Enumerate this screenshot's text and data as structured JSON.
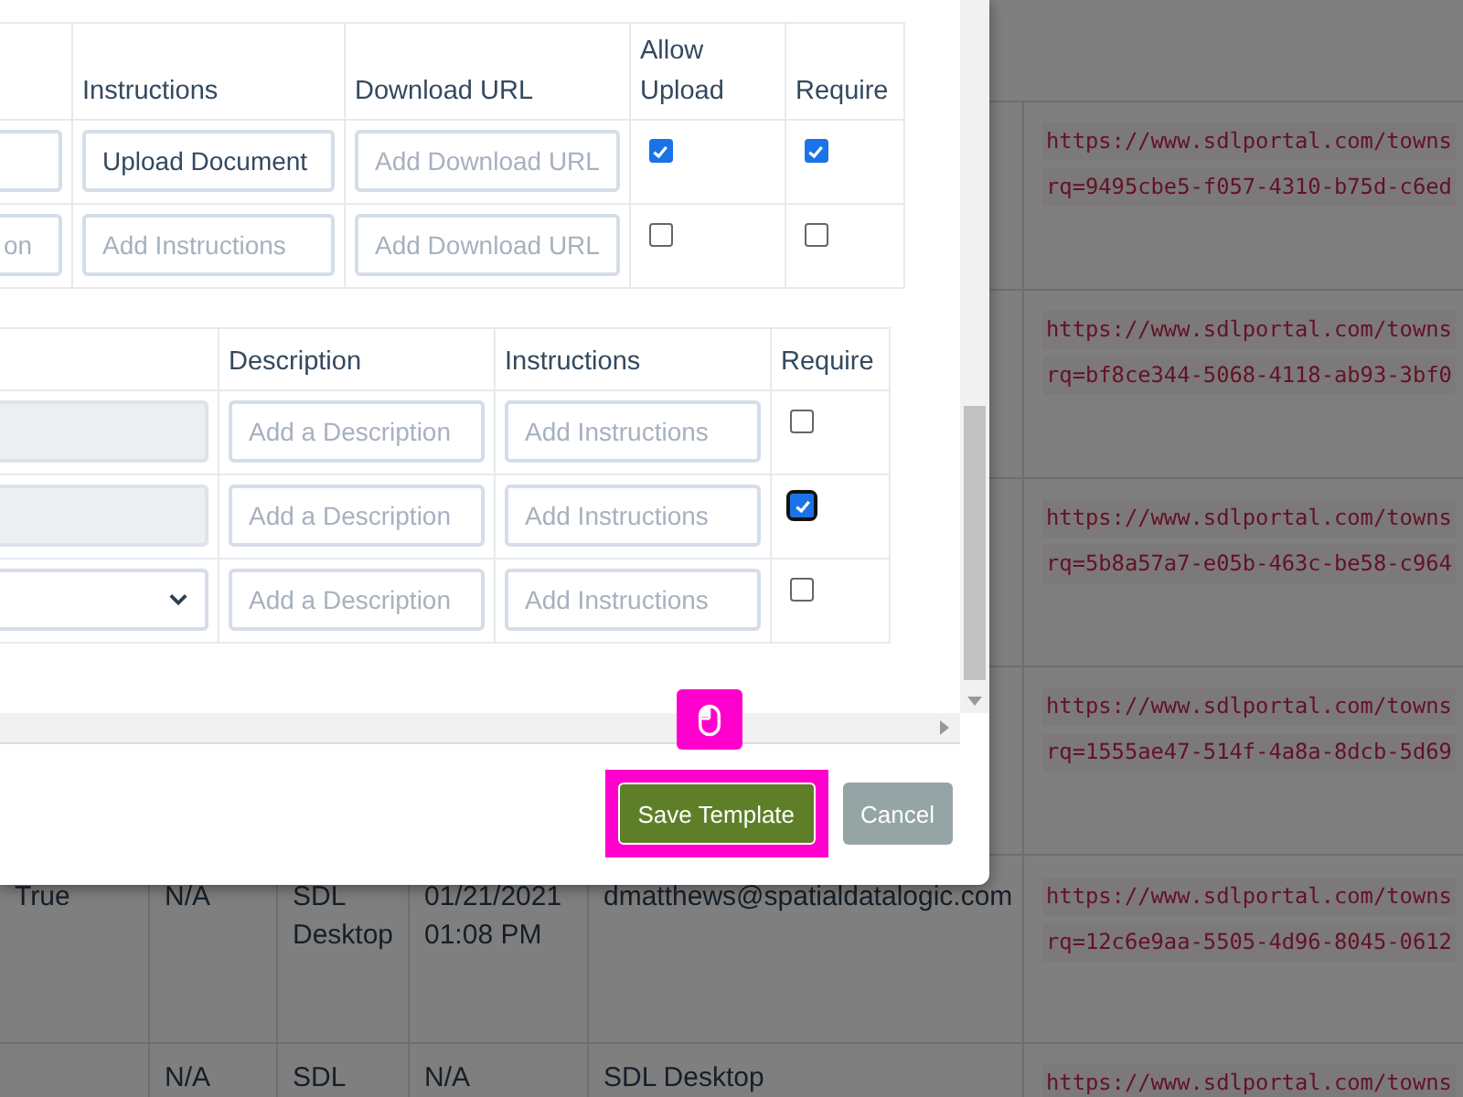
{
  "background_table": {
    "rows": [
      {
        "cells": [],
        "url_lines": [
          "https://www.sdlportal.com/towns",
          "rq=9495cbe5-f057-4310-b75d-c6ed"
        ]
      },
      {
        "cells": [],
        "url_lines": [
          "https://www.sdlportal.com/towns",
          "rq=bf8ce344-5068-4118-ab93-3bf0"
        ]
      },
      {
        "cells": [],
        "url_lines": [
          "https://www.sdlportal.com/towns",
          "rq=5b8a57a7-e05b-463c-be58-c964"
        ]
      },
      {
        "cells": [],
        "url_lines": [
          "https://www.sdlportal.com/towns",
          "rq=1555ae47-514f-4a8a-8dcb-5d69"
        ]
      },
      {
        "cells": [
          "True",
          "N/A",
          "SDL Desktop",
          "01/21/2021 01:08 PM",
          "dmatthews@spatialdatalogic.com"
        ],
        "url_lines": [
          "https://www.sdlportal.com/towns",
          "rq=12c6e9aa-5505-4d96-8045-0612"
        ]
      },
      {
        "cells": [
          "",
          "N/A",
          "SDL",
          "N/A",
          "SDL Desktop"
        ],
        "url_lines": [
          "https://www.sdlportal.com/towns"
        ]
      }
    ]
  },
  "modal": {
    "upload_table": {
      "columns": [
        "Instructions",
        "Download URL",
        "Allow Upload",
        "Require"
      ],
      "rows": [
        {
          "instructions": {
            "value": "Upload Document"
          },
          "download_url": {
            "placeholder": "Add Download URL"
          },
          "allow_upload": true,
          "require": true
        },
        {
          "column_1_placeholder": "on",
          "instructions": {
            "placeholder": "Add Instructions"
          },
          "download_url": {
            "placeholder": "Add Download URL"
          },
          "allow_upload": false,
          "require": false
        }
      ]
    },
    "documents_table": {
      "columns": [
        "Description",
        "Instructions",
        "Require"
      ],
      "rows": [
        {
          "kind": "locked",
          "description_placeholder": "Add a Description",
          "instructions_placeholder": "Add Instructions",
          "require": false,
          "focused": false
        },
        {
          "kind": "locked",
          "description_placeholder": "Add a Description",
          "instructions_placeholder": "Add Instructions",
          "require": true,
          "focused": true
        },
        {
          "kind": "select",
          "description_placeholder": "Add a Description",
          "instructions_placeholder": "Add Instructions",
          "require": false,
          "focused": false
        }
      ]
    },
    "buttons": [
      {
        "label": "Save Template",
        "kind": "primary",
        "highlighted": true
      },
      {
        "label": "Cancel",
        "kind": "secondary",
        "highlighted": false
      }
    ]
  }
}
